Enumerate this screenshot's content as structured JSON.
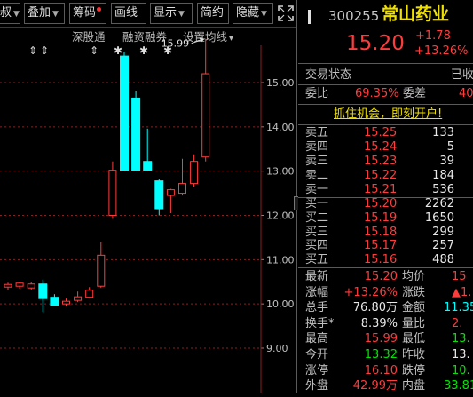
{
  "toolbar": {
    "items": [
      {
        "label": "叔",
        "arrow": true
      },
      {
        "label": "叠加",
        "arrow": true
      },
      {
        "label": "筹码",
        "dot": true
      },
      {
        "label": "画线"
      },
      {
        "label": "显示",
        "arrow": true
      },
      {
        "label": "简约"
      },
      {
        "label": "隐藏",
        "arrow": true
      }
    ]
  },
  "subtoolbar": {
    "shenbutong": "深股通",
    "rongzi": "融资融券",
    "settings": "设置均线",
    "settings_arrow": "▾"
  },
  "markers": [
    "⇕",
    "⇕",
    "⇕",
    "✱",
    "✱",
    "✱"
  ],
  "chart_data": {
    "type": "candlestick",
    "ylim": [
      8.9,
      15.8
    ],
    "y_ticks": [
      "15.00",
      "14.00",
      "13.00",
      "12.00",
      "11.00",
      "10.00",
      "9.00"
    ],
    "annotation": "15.99",
    "candles": [
      {
        "o": 10.38,
        "h": 10.48,
        "l": 10.32,
        "c": 10.44
      },
      {
        "o": 10.4,
        "h": 10.5,
        "l": 10.34,
        "c": 10.47
      },
      {
        "o": 10.36,
        "h": 10.5,
        "l": 10.32,
        "c": 10.45
      },
      {
        "o": 10.45,
        "h": 10.55,
        "l": 9.82,
        "c": 10.12
      },
      {
        "o": 10.15,
        "h": 10.22,
        "l": 9.95,
        "c": 9.97
      },
      {
        "o": 10.0,
        "h": 10.12,
        "l": 9.95,
        "c": 10.06
      },
      {
        "o": 10.08,
        "h": 10.28,
        "l": 10.04,
        "c": 10.16
      },
      {
        "o": 10.15,
        "h": 10.38,
        "l": 10.12,
        "c": 10.31
      },
      {
        "o": 10.4,
        "h": 11.4,
        "l": 10.36,
        "c": 11.1
      },
      {
        "o": 12.0,
        "h": 13.22,
        "l": 11.92,
        "c": 13.02
      },
      {
        "o": 15.6,
        "h": 15.7,
        "l": 13.02,
        "c": 13.02,
        "limit": "down"
      },
      {
        "o": 14.65,
        "h": 14.8,
        "l": 13.02,
        "c": 13.02
      },
      {
        "o": 13.22,
        "h": 13.96,
        "l": 13.02,
        "c": 13.02
      },
      {
        "o": 12.78,
        "h": 12.82,
        "l": 12.0,
        "c": 12.15
      },
      {
        "o": 12.45,
        "h": 12.6,
        "l": 12.05,
        "c": 12.58
      },
      {
        "o": 12.5,
        "h": 13.28,
        "l": 12.45,
        "c": 12.72
      },
      {
        "o": 12.72,
        "h": 13.38,
        "l": 12.65,
        "c": 13.22
      },
      {
        "o": 13.32,
        "h": 15.99,
        "l": 13.22,
        "c": 15.2
      }
    ]
  },
  "quote": {
    "code": "300255",
    "name": "常山药业",
    "price": "15.20",
    "change": "+1.78",
    "change_pct": "+13.26%"
  },
  "trade_status": {
    "label": "交易状态",
    "value": "已收"
  },
  "commission": {
    "ratio_label": "委比",
    "ratio_value": "69.35%",
    "diff_label": "委差",
    "diff_value": "40"
  },
  "promo": "抓住机会，即刻开户!",
  "asks": [
    {
      "label": "卖五",
      "price": "15.25",
      "vol": "133"
    },
    {
      "label": "卖四",
      "price": "15.24",
      "vol": "5"
    },
    {
      "label": "卖三",
      "price": "15.23",
      "vol": "39"
    },
    {
      "label": "卖二",
      "price": "15.22",
      "vol": "184"
    },
    {
      "label": "卖一",
      "price": "15.21",
      "vol": "536"
    }
  ],
  "bids": [
    {
      "label": "买一",
      "price": "15.20",
      "vol": "2262"
    },
    {
      "label": "买二",
      "price": "15.19",
      "vol": "1650"
    },
    {
      "label": "买三",
      "price": "15.18",
      "vol": "299"
    },
    {
      "label": "买四",
      "price": "15.17",
      "vol": "257"
    },
    {
      "label": "买五",
      "price": "15.16",
      "vol": "488"
    }
  ],
  "stats": [
    {
      "l1": "最新",
      "v1": "15.20",
      "c1": "red",
      "l2": "均价",
      "v2": "15",
      "c2": "red"
    },
    {
      "l1": "涨幅",
      "v1": "+13.26%",
      "c1": "red",
      "l2": "涨跌",
      "v2": "▲1.",
      "c2": "red"
    },
    {
      "l1": "总手",
      "v1": "76.80万",
      "c1": "white",
      "l2": "金额",
      "v2": "11.35",
      "c2": "cyan"
    },
    {
      "l1": "换手*",
      "v1": "8.39%",
      "c1": "white",
      "l2": "量比",
      "v2": "2.",
      "c2": "red"
    },
    {
      "l1": "最高",
      "v1": "15.99",
      "c1": "red",
      "l2": "最低",
      "v2": "13.",
      "c2": "green"
    },
    {
      "l1": "今开",
      "v1": "13.32",
      "c1": "green",
      "l2": "昨收",
      "v2": "13.",
      "c2": "white"
    },
    {
      "l1": "涨停",
      "v1": "16.10",
      "c1": "red",
      "l2": "跌停",
      "v2": "10.",
      "c2": "green"
    },
    {
      "l1": "外盘",
      "v1": "42.99万",
      "c1": "red",
      "l2": "内盘",
      "v2": "33.81",
      "c2": "green"
    }
  ],
  "colors": {
    "up": "#ff3c3c",
    "down": "#00ffff",
    "grid": "#8a2020",
    "axis": "#c0c0c0"
  }
}
